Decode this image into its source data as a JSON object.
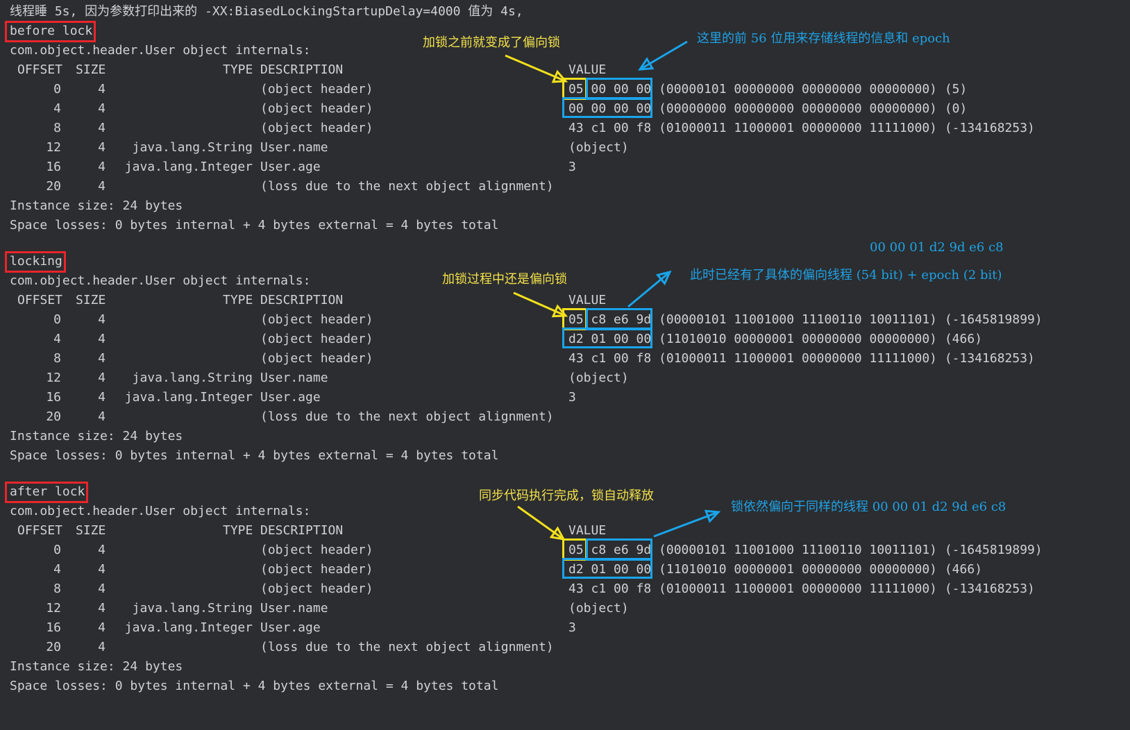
{
  "intro": "线程睡 5s, 因为参数打印出来的 -XX:BiasedLockingStartupDelay=4000 值为 4s,",
  "sections": [
    {
      "label": "before lock",
      "class_line": "com.object.header.User object internals:",
      "header": {
        "offset": "OFFSET",
        "size": "SIZE",
        "type": "TYPE",
        "desc": "DESCRIPTION",
        "value": "VALUE"
      },
      "rows": [
        {
          "offset": "0",
          "size": "4",
          "type": "",
          "desc": "(object header)",
          "value": "05 00 00 00 (00000101 00000000 00000000 00000000) (5)"
        },
        {
          "offset": "4",
          "size": "4",
          "type": "",
          "desc": "(object header)",
          "value": "00 00 00 00 (00000000 00000000 00000000 00000000) (0)"
        },
        {
          "offset": "8",
          "size": "4",
          "type": "",
          "desc": "(object header)",
          "value": "43 c1 00 f8 (01000011 11000001 00000000 11111000) (-134168253)"
        },
        {
          "offset": "12",
          "size": "4",
          "type": "java.lang.String",
          "desc": "User.name",
          "value": "(object)"
        },
        {
          "offset": "16",
          "size": "4",
          "type": "java.lang.Integer",
          "desc": "User.age",
          "value": "3"
        },
        {
          "offset": "20",
          "size": "4",
          "type": "",
          "desc": "(loss due to the next object alignment)",
          "value": ""
        }
      ],
      "instance_size": "Instance size: 24 bytes",
      "space_losses": "Space losses: 0 bytes internal + 4 bytes external = 4 bytes total",
      "annotation_yellow": "加锁之前就变成了偏向锁",
      "annotation_blue": "这里的前 56 位用来存储线程的信息和 epoch",
      "annotation_blue_top": ""
    },
    {
      "label": "locking",
      "class_line": "com.object.header.User object internals:",
      "header": {
        "offset": "OFFSET",
        "size": "SIZE",
        "type": "TYPE",
        "desc": "DESCRIPTION",
        "value": "VALUE"
      },
      "rows": [
        {
          "offset": "0",
          "size": "4",
          "type": "",
          "desc": "(object header)",
          "value": "05 c8 e6 9d (00000101 11001000 11100110 10011101) (-1645819899)"
        },
        {
          "offset": "4",
          "size": "4",
          "type": "",
          "desc": "(object header)",
          "value": "d2 01 00 00 (11010010 00000001 00000000 00000000) (466)"
        },
        {
          "offset": "8",
          "size": "4",
          "type": "",
          "desc": "(object header)",
          "value": "43 c1 00 f8 (01000011 11000001 00000000 11111000) (-134168253)"
        },
        {
          "offset": "12",
          "size": "4",
          "type": "java.lang.String",
          "desc": "User.name",
          "value": "(object)"
        },
        {
          "offset": "16",
          "size": "4",
          "type": "java.lang.Integer",
          "desc": "User.age",
          "value": "3"
        },
        {
          "offset": "20",
          "size": "4",
          "type": "",
          "desc": "(loss due to the next object alignment)",
          "value": ""
        }
      ],
      "instance_size": "Instance size: 24 bytes",
      "space_losses": "Space losses: 0 bytes internal + 4 bytes external = 4 bytes total",
      "annotation_yellow": "加锁过程中还是偏向锁",
      "annotation_blue": "此时已经有了具体的偏向线程 (54 bit) + epoch (2 bit)",
      "annotation_blue_top": "00 00 01 d2 9d e6 c8"
    },
    {
      "label": "after lock",
      "class_line": "com.object.header.User object internals:",
      "header": {
        "offset": "OFFSET",
        "size": "SIZE",
        "type": "TYPE",
        "desc": "DESCRIPTION",
        "value": "VALUE"
      },
      "rows": [
        {
          "offset": "0",
          "size": "4",
          "type": "",
          "desc": "(object header)",
          "value": "05 c8 e6 9d (00000101 11001000 11100110 10011101) (-1645819899)"
        },
        {
          "offset": "4",
          "size": "4",
          "type": "",
          "desc": "(object header)",
          "value": "d2 01 00 00 (11010010 00000001 00000000 00000000) (466)"
        },
        {
          "offset": "8",
          "size": "4",
          "type": "",
          "desc": "(object header)",
          "value": "43 c1 00 f8 (01000011 11000001 00000000 11111000) (-134168253)"
        },
        {
          "offset": "12",
          "size": "4",
          "type": "java.lang.String",
          "desc": "User.name",
          "value": "(object)"
        },
        {
          "offset": "16",
          "size": "4",
          "type": "java.lang.Integer",
          "desc": "User.age",
          "value": "3"
        },
        {
          "offset": "20",
          "size": "4",
          "type": "",
          "desc": "(loss due to the next object alignment)",
          "value": ""
        }
      ],
      "instance_size": "Instance size: 24 bytes",
      "space_losses": "Space losses: 0 bytes internal + 4 bytes external = 4 bytes total",
      "annotation_yellow": "同步代码执行完成，锁自动释放",
      "annotation_blue": "锁依然偏向于同样的线程   00 00 01 d2 9d e6 c8",
      "annotation_blue_top": ""
    }
  ],
  "colors": {
    "background": "#2b2d30",
    "text": "#cfd2d6",
    "label_box": "#e8252b",
    "highlight_yellow": "#f2e01d",
    "highlight_blue": "#1aa4ea"
  }
}
